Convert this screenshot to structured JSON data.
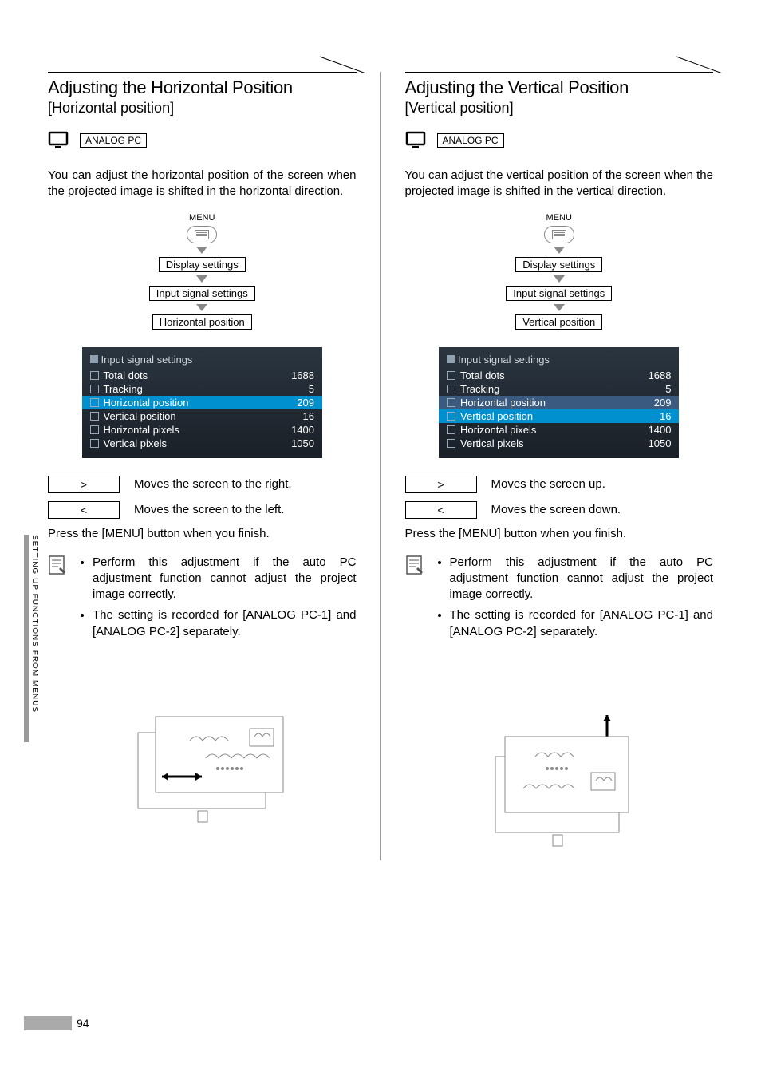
{
  "sideTab": "SETTING UP FUNCTIONS FROM MENUS",
  "pageNumber": "94",
  "left": {
    "title": "Adjusting the Horizontal Position",
    "bracket": "[Horizontal position]",
    "mode": "ANALOG PC",
    "intro": "You can adjust the horizontal position of the screen when the projected image is shifted in the horizontal direction.",
    "menuLabel": "MENU",
    "flow": [
      "Display settings",
      "Input signal settings",
      "Horizontal position"
    ],
    "osdTitle": "Input signal settings",
    "osd": [
      {
        "name": "Total dots",
        "val": "1688"
      },
      {
        "name": "Tracking",
        "val": "5"
      },
      {
        "name": "Horizontal position",
        "val": "209",
        "hl": true
      },
      {
        "name": "Vertical position",
        "val": "16"
      },
      {
        "name": "Horizontal pixels",
        "val": "1400"
      },
      {
        "name": "Vertical pixels",
        "val": "1050"
      }
    ],
    "keyRight": ">",
    "keyRightDesc": "Moves the screen to the right.",
    "keyLeft": "<",
    "keyLeftDesc": "Moves the screen to the left.",
    "finish": "Press the [MENU] button when you finish.",
    "notes": [
      "Perform this adjustment if the auto PC adjustment function cannot adjust the project image correctly.",
      "The setting is recorded for [ANALOG PC-1] and [ANALOG PC-2] separately."
    ]
  },
  "right": {
    "title": "Adjusting the Vertical Position",
    "bracket": "[Vertical position]",
    "mode": "ANALOG PC",
    "intro": "You can adjust the vertical position of the screen when the projected image is shifted in the vertical direction.",
    "menuLabel": "MENU",
    "flow": [
      "Display settings",
      "Input signal settings",
      "Vertical position"
    ],
    "osdTitle": "Input signal settings",
    "osd": [
      {
        "name": "Total dots",
        "val": "1688"
      },
      {
        "name": "Tracking",
        "val": "5"
      },
      {
        "name": "Horizontal position",
        "val": "209",
        "hl2": true
      },
      {
        "name": "Vertical position",
        "val": "16",
        "hl": true
      },
      {
        "name": "Horizontal pixels",
        "val": "1400"
      },
      {
        "name": "Vertical pixels",
        "val": "1050"
      }
    ],
    "keyRight": ">",
    "keyRightDesc": "Moves the screen up.",
    "keyLeft": "<",
    "keyLeftDesc": "Moves the screen down.",
    "finish": "Press the [MENU] button when you finish.",
    "notes": [
      "Perform this adjustment if the auto PC adjustment function cannot adjust the project image correctly.",
      "The setting is recorded for [ANALOG PC-1] and [ANALOG PC-2] separately."
    ]
  }
}
